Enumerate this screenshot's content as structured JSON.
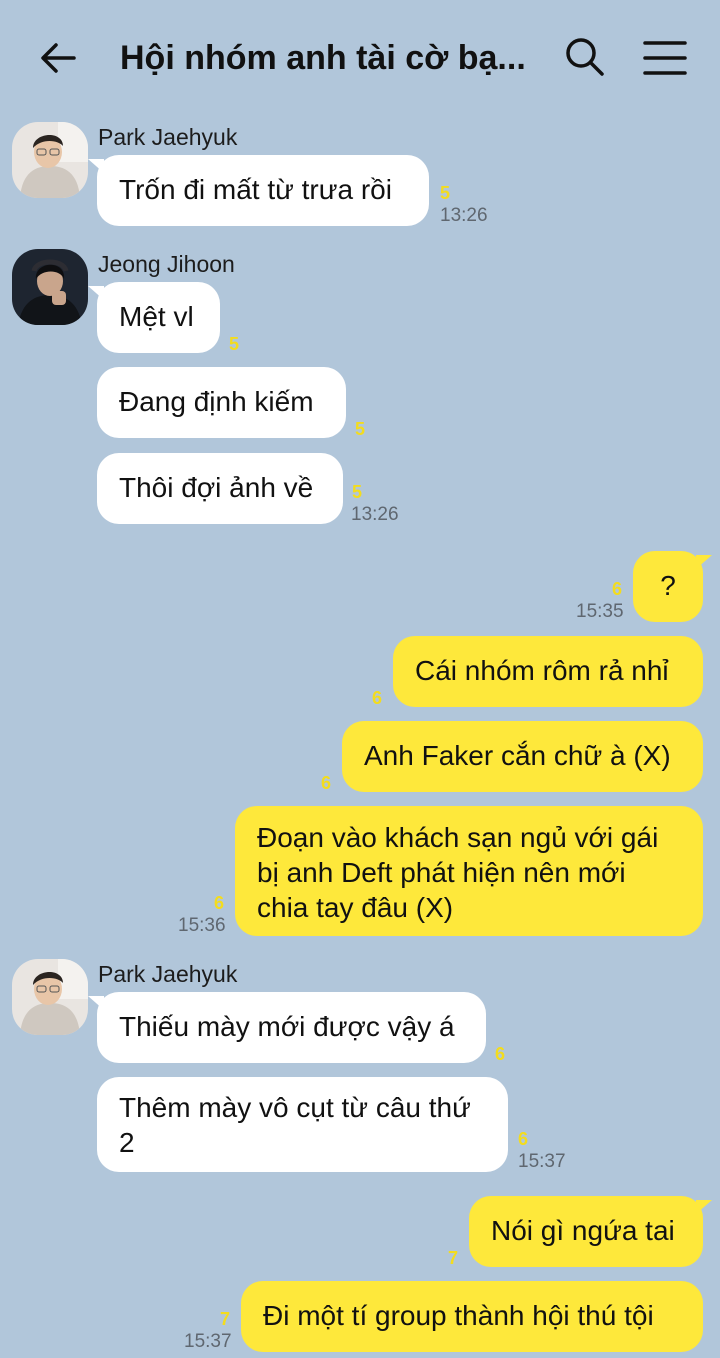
{
  "header": {
    "title": "Hội nhóm anh tài cờ bạ..."
  },
  "senders": {
    "s1": "Park Jaehyuk",
    "s2": "Jeong Jihoon",
    "s3": "Park Jaehyuk"
  },
  "messages": [
    {
      "text": "Trốn đi mất từ trưa rồi",
      "unread": "5",
      "time": "13:26"
    },
    {
      "text": "Mệt vl",
      "unread": "5"
    },
    {
      "text": "Đang định kiếm",
      "unread": "5"
    },
    {
      "text": "Thôi đợi ảnh về",
      "unread": "5",
      "time": "13:26"
    },
    {
      "text": "?",
      "unread": "6",
      "time": "15:35"
    },
    {
      "text": "Cái nhóm rôm rả nhỉ",
      "unread": "6"
    },
    {
      "text": "Anh Faker cắn chữ à (X)",
      "unread": "6"
    },
    {
      "text": "Đoạn vào khách sạn ngủ với gái bị anh Deft phát hiện nên mới chia tay đâu (X)",
      "unread": "6",
      "time": "15:36"
    },
    {
      "text": "Thiếu mày mới được vậy á",
      "unread": "6"
    },
    {
      "text": "Thêm mày vô cụt từ câu thứ 2",
      "unread": "6",
      "time": "15:37"
    },
    {
      "text": "Nói gì ngứa tai",
      "unread": "7"
    },
    {
      "text": "Đi một tí group thành hội thú tội",
      "unread": "7",
      "time": "15:37"
    }
  ],
  "colors": {
    "background": "#b1c6da",
    "outgoing_bubble": "#fee83b",
    "incoming_bubble": "#ffffff",
    "unread_count": "#f3dc1e"
  },
  "icons": [
    "back-arrow-icon",
    "search-icon",
    "menu-icon"
  ]
}
